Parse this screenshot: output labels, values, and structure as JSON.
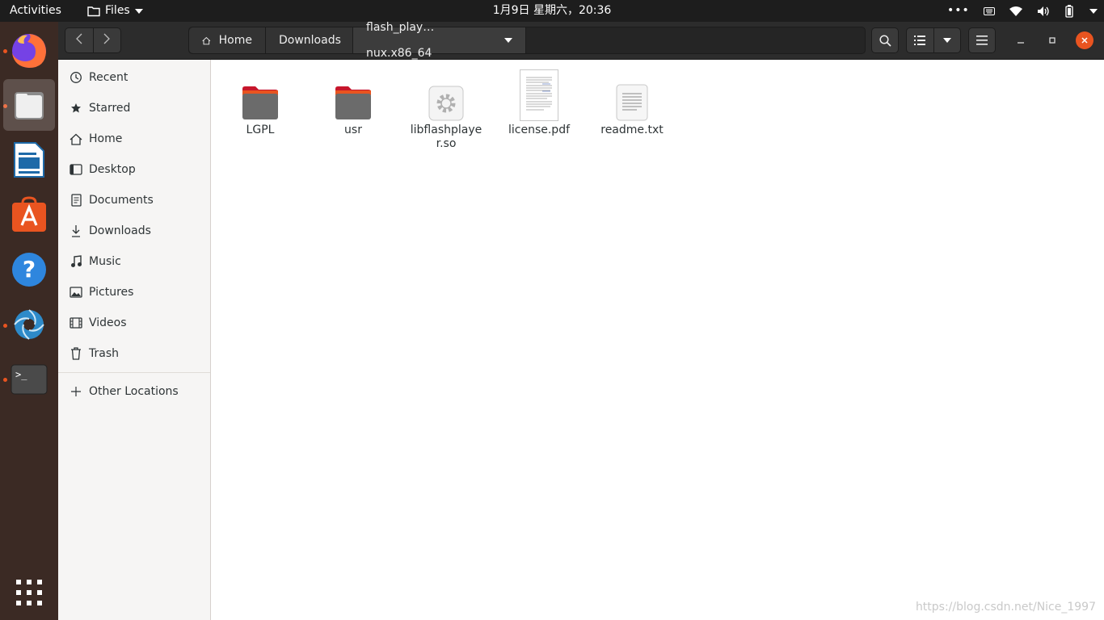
{
  "topbar": {
    "activities": "Activities",
    "app_name": "Files",
    "clock": "1月9日 星期六，20:36",
    "tray_icons": [
      "more-icon",
      "keyboard-icon",
      "wifi-icon",
      "volume-icon",
      "battery-icon",
      "chevron-down-icon"
    ]
  },
  "dock": {
    "items": [
      {
        "name": "firefox",
        "icon": "firefox-icon",
        "running": true
      },
      {
        "name": "files",
        "icon": "files-icon",
        "running": true,
        "active": true
      },
      {
        "name": "libreoffice-writer",
        "icon": "writer-icon",
        "running": false
      },
      {
        "name": "ubuntu-software",
        "icon": "software-icon",
        "running": false
      },
      {
        "name": "help",
        "icon": "help-icon",
        "running": false
      },
      {
        "name": "shutter",
        "icon": "aperture-icon",
        "running": true
      },
      {
        "name": "terminal",
        "icon": "terminal-icon",
        "running": true
      }
    ],
    "show_apps_icon": "grid-icon",
    "accent": "#e95420"
  },
  "header": {
    "back_icon": "chevron-left-icon",
    "forward_icon": "chevron-right-icon",
    "breadcrumbs": [
      "Home",
      "Downloads",
      "flash_play…nux.x86_64"
    ],
    "search_icon": "search-icon",
    "view_icon": "list-view-icon",
    "menu_icon": "hamburger-icon"
  },
  "sidebar": {
    "items": [
      {
        "label": "Recent",
        "icon": "clock-icon"
      },
      {
        "label": "Starred",
        "icon": "star-icon"
      },
      {
        "label": "Home",
        "icon": "home-icon"
      },
      {
        "label": "Desktop",
        "icon": "desktop-icon"
      },
      {
        "label": "Documents",
        "icon": "document-icon"
      },
      {
        "label": "Downloads",
        "icon": "download-icon"
      },
      {
        "label": "Music",
        "icon": "music-icon"
      },
      {
        "label": "Pictures",
        "icon": "picture-icon"
      },
      {
        "label": "Videos",
        "icon": "video-icon"
      },
      {
        "label": "Trash",
        "icon": "trash-icon"
      }
    ],
    "other": {
      "label": "Other Locations",
      "icon": "plus-icon"
    }
  },
  "files": [
    {
      "name": "LGPL",
      "type": "folder"
    },
    {
      "name": "usr",
      "type": "folder"
    },
    {
      "name": "libflashplayer.so",
      "type": "library"
    },
    {
      "name": "license.pdf",
      "type": "pdf"
    },
    {
      "name": "readme.txt",
      "type": "text"
    }
  ],
  "watermark": "https://blog.csdn.net/Nice_1997"
}
